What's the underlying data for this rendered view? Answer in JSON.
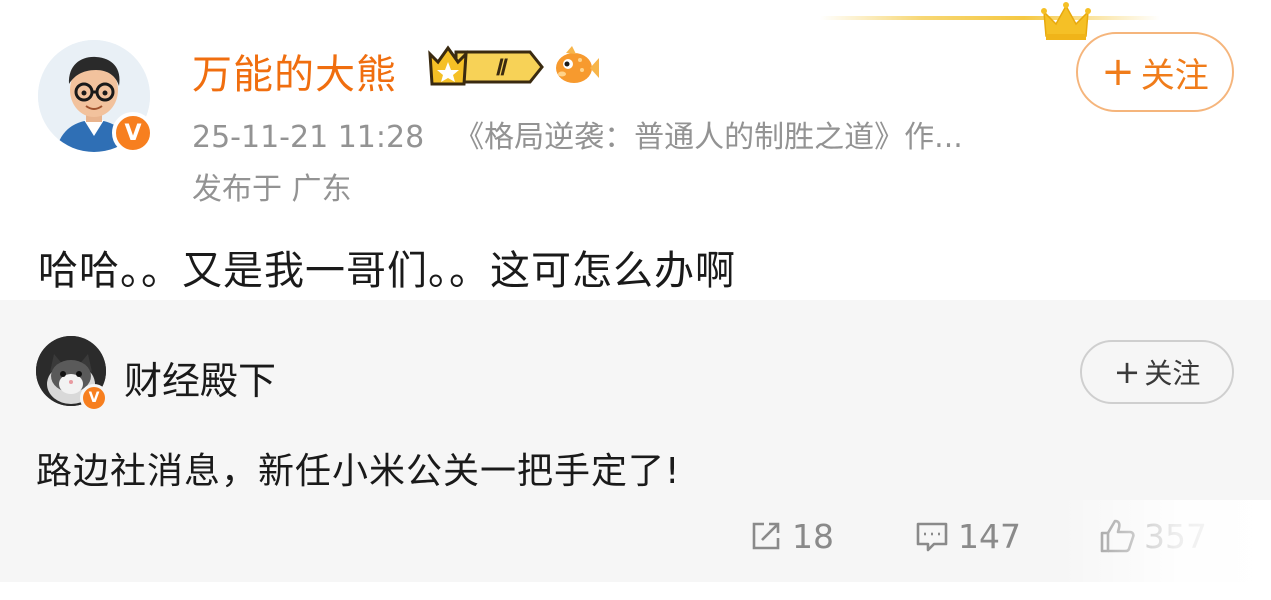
{
  "post": {
    "author": {
      "name": "万能的大熊",
      "level_badge": "Ⅱ",
      "verified_badge": "V",
      "avatar_icon": "cartoon-man-avatar",
      "fish_icon": "orange-fish-icon"
    },
    "timestamp": "25-11-21 11:28",
    "source": "《格局逆袭：普通人的制胜之道》作...",
    "location": "发布于 广东",
    "follow_label": "关注",
    "follow_plus": "+",
    "text": "哈哈。。又是我一哥们。。这可怎么办啊"
  },
  "repost": {
    "author": {
      "name": "财经殿下",
      "verified_badge": "V",
      "avatar_icon": "cat-avatar"
    },
    "follow_label": "关注",
    "follow_plus": "+",
    "text": "路边社消息，新任小米公关一把手定了!",
    "actions": {
      "repost_count": "18",
      "comment_count": "147",
      "like_count": "357"
    }
  },
  "colors": {
    "accent": "#f06e0f",
    "verified": "#f77f1f",
    "muted": "#939393",
    "repost_bg": "#f6f6f6"
  }
}
